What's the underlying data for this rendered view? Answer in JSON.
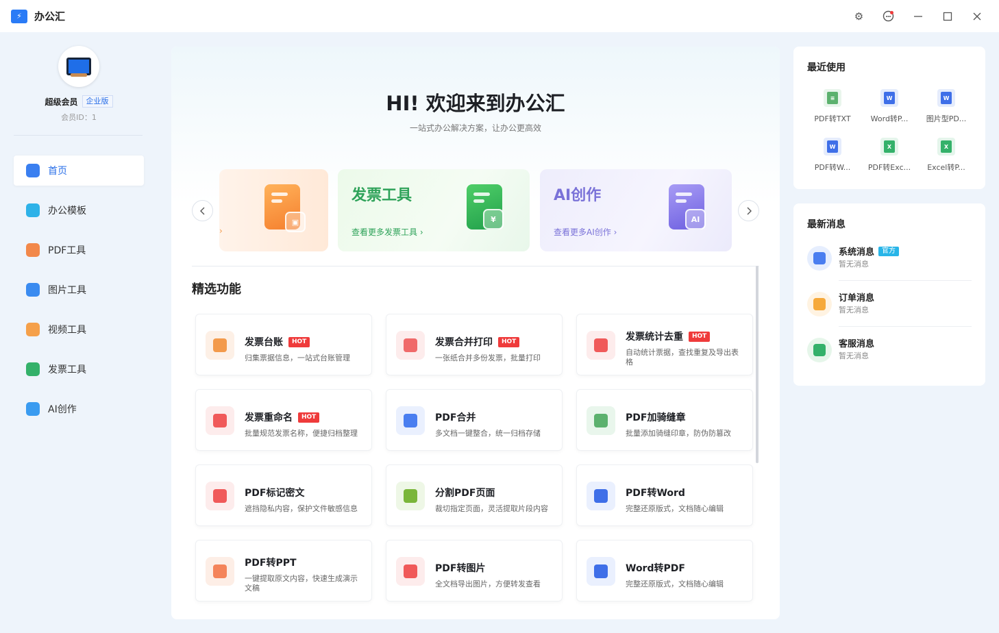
{
  "app": {
    "title": "办公汇"
  },
  "user": {
    "member": "超级会员",
    "edition": "企业版",
    "id_text": "会员ID：1"
  },
  "nav": [
    {
      "label": "首页",
      "icon": "home-icon",
      "color": "#3a7ff0",
      "active": true
    },
    {
      "label": "办公模板",
      "icon": "briefcase-icon",
      "color": "#2eb2e8"
    },
    {
      "label": "PDF工具",
      "icon": "pdf-icon",
      "color": "#f2884a"
    },
    {
      "label": "图片工具",
      "icon": "image-icon",
      "color": "#3a8bf0"
    },
    {
      "label": "视频工具",
      "icon": "video-icon",
      "color": "#f5a04a"
    },
    {
      "label": "发票工具",
      "icon": "invoice-icon",
      "color": "#34b16a"
    },
    {
      "label": "AI创作",
      "icon": "ai-icon",
      "color": "#3a9bf0"
    }
  ],
  "hero": {
    "title": "HI! 欢迎来到办公汇",
    "subtitle": "一站式办公解决方案，让办公更高效"
  },
  "banners": [
    {
      "title": "",
      "link": ""
    },
    {
      "title": "发票工具",
      "link": "查看更多发票工具",
      "color": "#2ea259"
    },
    {
      "title": "AI创作",
      "link": "查看更多AI创作",
      "color": "#7a72d8"
    }
  ],
  "section": {
    "title": "精选功能"
  },
  "features": [
    {
      "title": "发票台账",
      "desc": "归集票据信息，一站式台账管理",
      "hot": "HOT",
      "icon": "home-ledger-icon",
      "bg": "#fdf0e6",
      "fg": "#f39a4b"
    },
    {
      "title": "发票合并打印",
      "desc": "一张纸合并多份发票，批量打印",
      "hot": "HOT",
      "icon": "printer-icon",
      "bg": "#fdecec",
      "fg": "#f06a6a"
    },
    {
      "title": "发票统计去重",
      "desc": "自动统计票据，查找重复及导出表格",
      "hot": "HOT",
      "icon": "statistics-icon",
      "bg": "#fdecec",
      "fg": "#f05a5a"
    },
    {
      "title": "发票重命名",
      "desc": "批量规范发票名称，便捷归档整理",
      "hot": "HOT",
      "icon": "rename-icon",
      "bg": "#fdecec",
      "fg": "#f05a5a"
    },
    {
      "title": "PDF合并",
      "desc": "多文档一键整合，统一归档存储",
      "hot": "",
      "icon": "merge-icon",
      "bg": "#eaf0fe",
      "fg": "#4a7ef0"
    },
    {
      "title": "PDF加骑缝章",
      "desc": "批量添加骑缝印章，防伪防篡改",
      "hot": "",
      "icon": "seal-icon",
      "bg": "#e9f6ec",
      "fg": "#5cb16e"
    },
    {
      "title": "PDF标记密文",
      "desc": "遮挡隐私内容，保护文件敏感信息",
      "hot": "",
      "icon": "mask-icon",
      "bg": "#fdecec",
      "fg": "#f05a5a"
    },
    {
      "title": "分割PDF页面",
      "desc": "裁切指定页面，灵活提取片段内容",
      "hot": "",
      "icon": "scissors-icon",
      "bg": "#eef7e6",
      "fg": "#7ab63a"
    },
    {
      "title": "PDF转Word",
      "desc": "完整还原版式，文档随心编辑",
      "hot": "",
      "icon": "word-icon",
      "bg": "#eaf0fe",
      "fg": "#3f6fe8"
    },
    {
      "title": "PDF转PPT",
      "desc": "一键提取原文内容，快速生成演示文稿",
      "hot": "",
      "icon": "ppt-icon",
      "bg": "#fdeee6",
      "fg": "#f4845a"
    },
    {
      "title": "PDF转图片",
      "desc": "全文档导出图片，方便转发查看",
      "hot": "",
      "icon": "picture-icon",
      "bg": "#fdecec",
      "fg": "#f05a5a"
    },
    {
      "title": "Word转PDF",
      "desc": "完整还原版式，文档随心编辑",
      "hot": "",
      "icon": "word-icon",
      "bg": "#eaf0fe",
      "fg": "#3f6fe8"
    }
  ],
  "recent": {
    "title": "最近使用",
    "items": [
      {
        "label": "PDF转TXT",
        "icon": "txt-file-icon",
        "color": "#5cb16e",
        "glyph": "≡"
      },
      {
        "label": "Word转P...",
        "icon": "word-file-icon",
        "color": "#3f6fe8",
        "glyph": "W"
      },
      {
        "label": "图片型PD...",
        "icon": "word-file-icon",
        "color": "#3f6fe8",
        "glyph": "W"
      },
      {
        "label": "PDF转W...",
        "icon": "word-file-icon",
        "color": "#3f6fe8",
        "glyph": "W"
      },
      {
        "label": "PDF转Exc...",
        "icon": "excel-file-icon",
        "color": "#34b16a",
        "glyph": "X"
      },
      {
        "label": "Excel转P...",
        "icon": "excel-file-icon",
        "color": "#34b16a",
        "glyph": "X"
      }
    ]
  },
  "messages": {
    "title": "最新消息",
    "items": [
      {
        "title": "系统消息",
        "badge": "官方",
        "sub": "暂无消息",
        "icon": "system-message-icon",
        "bg": "#e6eefe",
        "fg": "#4a7ef0"
      },
      {
        "title": "订单消息",
        "badge": "",
        "sub": "暂无消息",
        "icon": "bell-icon",
        "bg": "#fff3e2",
        "fg": "#f6a93a"
      },
      {
        "title": "客服消息",
        "badge": "",
        "sub": "暂无消息",
        "icon": "headset-icon",
        "bg": "#e6f6ea",
        "fg": "#34b16a"
      }
    ]
  }
}
